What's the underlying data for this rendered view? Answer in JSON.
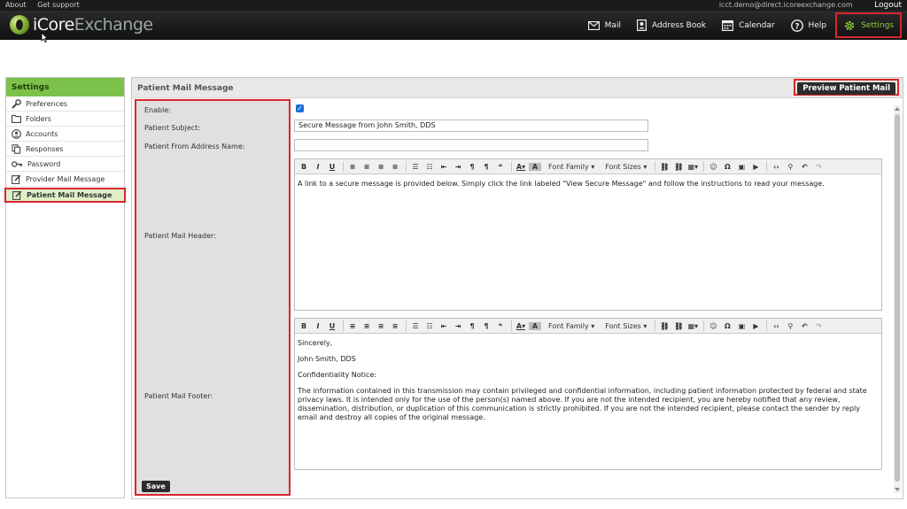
{
  "topbar": {
    "about": "About",
    "support": "Get support",
    "email": "icct.demo@direct.icoreexchange.com",
    "logout": "Logout"
  },
  "brand": {
    "name_a": "iCore",
    "name_b": "Exchange"
  },
  "nav": {
    "mail": "Mail",
    "address_book": "Address Book",
    "calendar": "Calendar",
    "help": "Help",
    "settings": "Settings"
  },
  "sidebar": {
    "title": "Settings",
    "items": [
      {
        "label": "Preferences",
        "icon": "wrench-icon"
      },
      {
        "label": "Folders",
        "icon": "folder-icon"
      },
      {
        "label": "Accounts",
        "icon": "user-circle-icon"
      },
      {
        "label": "Responses",
        "icon": "copy-icon"
      },
      {
        "label": "Password",
        "icon": "key-icon"
      },
      {
        "label": "Provider Mail Message",
        "icon": "edit-icon"
      },
      {
        "label": "Patient Mail Message",
        "icon": "edit-icon"
      }
    ]
  },
  "panel": {
    "title": "Patient Mail Message",
    "preview_button": "Preview Patient Mail",
    "save_button": "Save",
    "labels": {
      "enable": "Enable:",
      "subject": "Patient Subject:",
      "from_name": "Patient From Address Name:",
      "header": "Patient Mail Header:",
      "footer": "Patient Mail Footer:"
    },
    "subject_value": "Secure Message from John Smith, DDS",
    "from_name_value": "",
    "header_text": "A link to a secure message is provided below. Simply click the link labeled \"View Secure Message\" and follow the instructions to read your message.",
    "footer": {
      "line1": "Sincerely,",
      "line2": "John Smith, DDS",
      "line3": "Confidentiality Notice:",
      "line4": "The information contained in this transmission may contain privileged and confidential information, including patient information protected by federal and state privacy laws. It is intended only for the use of the person(s) named above. If you are not the intended recipient, you are hereby notified that any review, dissemination, distribution, or duplication of this communication is strictly prohibited. If you are not the intended recipient, please contact the sender by reply email and destroy all copies of the original message."
    }
  },
  "toolbar": {
    "font_family": "Font Family",
    "font_sizes": "Font Sizes"
  },
  "colors": {
    "accent_green": "#7cc24a",
    "highlight_red": "#d9262b"
  }
}
